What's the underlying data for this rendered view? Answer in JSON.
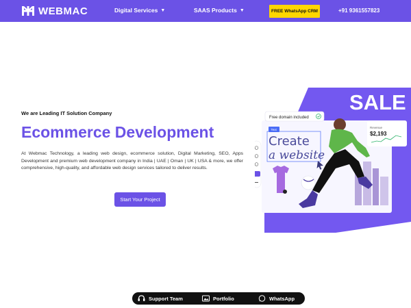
{
  "header": {
    "brand": "WEBMAC",
    "nav": [
      {
        "label": "Digital Services"
      },
      {
        "label": "SAAS Products"
      }
    ],
    "crm_button": "FREE WhatsApp CRM",
    "phone": "+91 9361557823"
  },
  "hero": {
    "eyebrow": "We are Leading IT Solution Company",
    "title": "Ecommerce Development",
    "description": "At Webmac Technology, a leading web design, ecommerce solution, Digital Marketing, SEO, Apps Development and premium web development company in India | UAE | Oman | UK | USA & more, we offer comprehensive, high-quality, and affordable web design services tailored to deliver results.",
    "cta": "Start Your Project"
  },
  "illustration": {
    "sale": "SALE",
    "domain_badge": "Free domain included",
    "tag": "Text",
    "create_line1": "Create",
    "create_line2": "a website",
    "revenue_label": "Revenue",
    "revenue_value": "$2,193"
  },
  "bottom_bar": {
    "support": "Support Team",
    "portfolio": "Portfolio",
    "whatsapp": "WhatsApp"
  },
  "colors": {
    "brand": "#6b52e6",
    "crm": "#ffd600",
    "bar": "#111111"
  }
}
